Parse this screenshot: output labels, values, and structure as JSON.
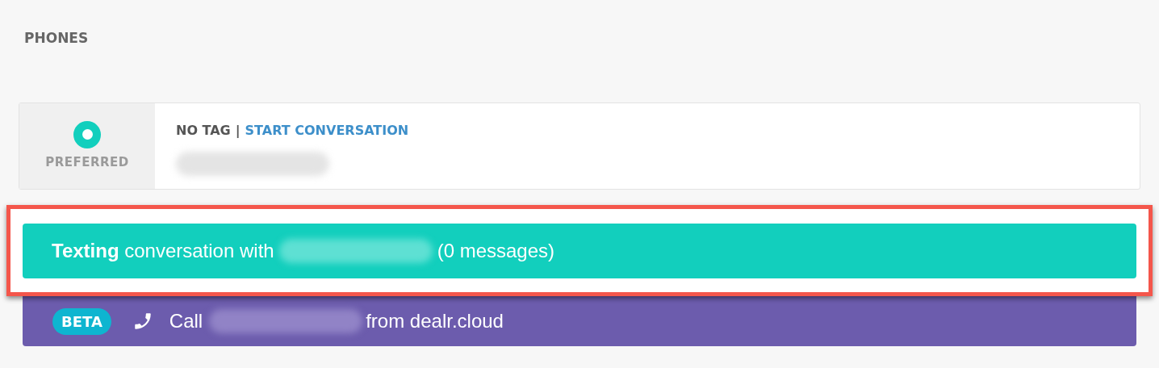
{
  "section_title": "PHONES",
  "phones": [
    {
      "preferred": true,
      "preferred_label": "PREFERRED",
      "tag": "NO TAG",
      "separator": "|",
      "action": "START CONVERSATION"
    }
  ],
  "texting": {
    "lead": "**Texting** conversation with",
    "count": "(0 messages)"
  },
  "call": {
    "badge": "BETA",
    "prefix": "Call",
    "suffix": "from dealr.cloud"
  }
}
